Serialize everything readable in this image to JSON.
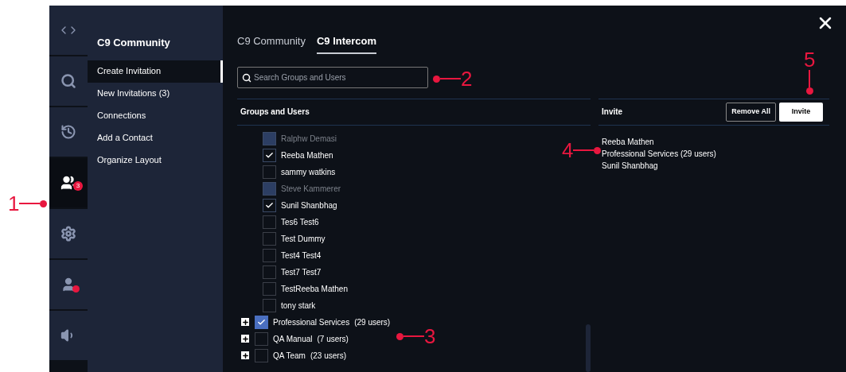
{
  "rail": [
    {
      "selected": false
    },
    {
      "selected": false
    },
    {
      "selected": false
    },
    {
      "selected": true,
      "badge": "3"
    },
    {
      "selected": false
    },
    {
      "selected": false,
      "status_dot": true
    },
    {
      "selected": false
    }
  ],
  "sidebar": {
    "title": "C9 Community",
    "items": [
      {
        "label": "Create Invitation",
        "selected": true
      },
      {
        "label": "New Invitations (3)",
        "selected": false
      },
      {
        "label": "Connections",
        "selected": false
      },
      {
        "label": "Add a Contact",
        "selected": false
      },
      {
        "label": "Organize Layout",
        "selected": false
      }
    ]
  },
  "tabs": [
    {
      "label": "C9 Community",
      "selected": false
    },
    {
      "label": "C9 Intercom",
      "selected": true
    }
  ],
  "search": {
    "placeholder": "Search Groups and Users"
  },
  "groups_heading": "Groups and Users",
  "entries": [
    {
      "kind": "user",
      "name": "Ralphw Demasi",
      "checked": false,
      "disabled": true
    },
    {
      "kind": "user",
      "name": "Reeba Mathen",
      "checked": true,
      "disabled": false
    },
    {
      "kind": "user",
      "name": "sammy watkins",
      "checked": false,
      "disabled": false
    },
    {
      "kind": "user",
      "name": "Steve Kammerer",
      "checked": false,
      "disabled": true
    },
    {
      "kind": "user",
      "name": "Sunil Shanbhag",
      "checked": true,
      "disabled": false
    },
    {
      "kind": "user",
      "name": "Tes6 Test6",
      "checked": false,
      "disabled": false
    },
    {
      "kind": "user",
      "name": "Test Dummy",
      "checked": false,
      "disabled": false
    },
    {
      "kind": "user",
      "name": "Test4 Test4",
      "checked": false,
      "disabled": false
    },
    {
      "kind": "user",
      "name": "Test7 Test7",
      "checked": false,
      "disabled": false
    },
    {
      "kind": "user",
      "name": "TestReeba Mathen",
      "checked": false,
      "disabled": false
    },
    {
      "kind": "user",
      "name": "tony stark",
      "checked": false,
      "disabled": false
    },
    {
      "kind": "group",
      "name": "Professional Services",
      "count": "(29 users)",
      "checked": true,
      "disabled": false
    },
    {
      "kind": "group",
      "name": "QA Manual",
      "count": "(7 users)",
      "checked": false,
      "disabled": false
    },
    {
      "kind": "group",
      "name": "QA Team",
      "count": "(23 users)",
      "checked": false,
      "disabled": false
    }
  ],
  "invite": {
    "heading": "Invite",
    "remove_all": "Remove All",
    "invite_button": "Invite",
    "selected": [
      "Reeba Mathen",
      "Professional Services (29 users)",
      "Sunil Shanbhag"
    ]
  },
  "callouts": [
    "1",
    "2",
    "3",
    "4",
    "5"
  ]
}
